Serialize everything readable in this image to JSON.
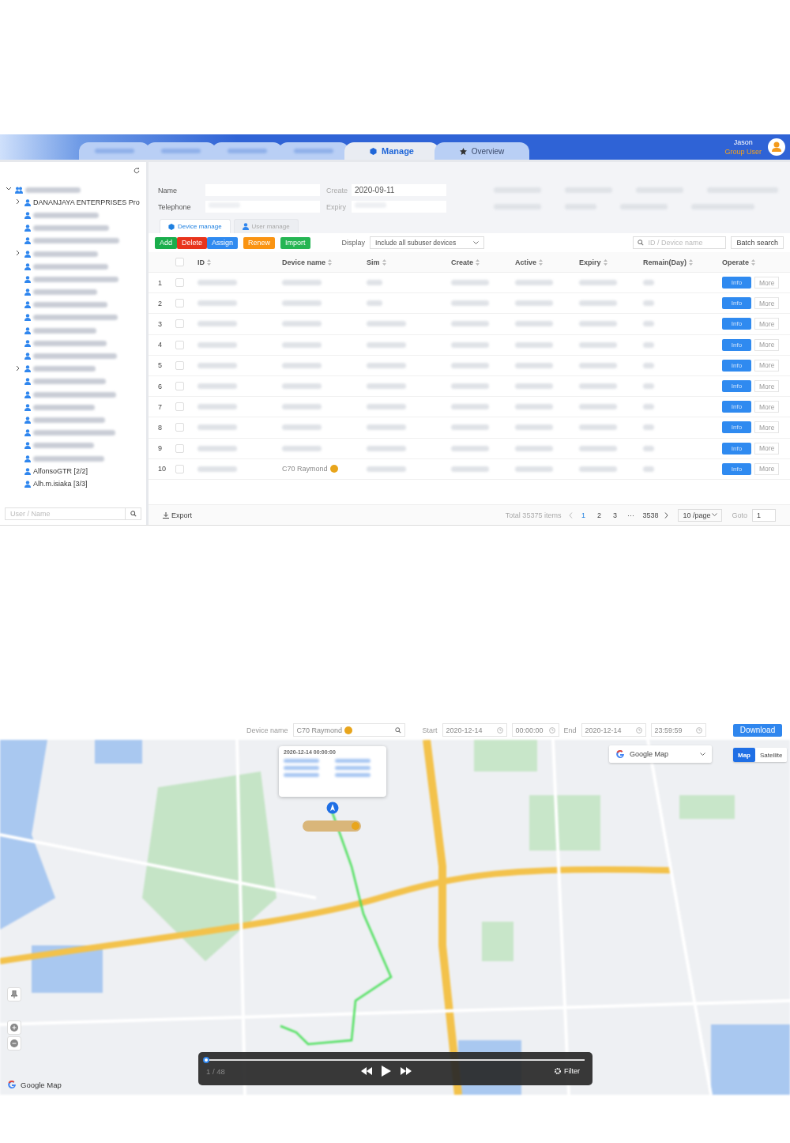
{
  "header": {
    "tabs": [
      {
        "kind": "blurred",
        "selected": false
      },
      {
        "kind": "blurred",
        "selected": false
      },
      {
        "kind": "blurred",
        "selected": false
      },
      {
        "kind": "blurred",
        "selected": false
      },
      {
        "kind": "cube",
        "label": "Manage",
        "selected": true
      },
      {
        "kind": "star",
        "label": "Overview",
        "selected": false
      }
    ],
    "user": {
      "name": "Jason",
      "role": "Group User"
    }
  },
  "sidebar": {
    "tree": {
      "kind": "blurred",
      "expanded": true,
      "children": [
        {
          "kind": "text",
          "label": "DANANJAYA ENTERPRISES Pro",
          "has_children": true
        },
        {
          "kind": "blurred",
          "has_children": false
        },
        {
          "kind": "blurred",
          "has_children": false
        },
        {
          "kind": "blurred",
          "has_children": false
        },
        {
          "kind": "blurred",
          "has_children": true
        },
        {
          "kind": "blurred",
          "has_children": false
        },
        {
          "kind": "blurred",
          "has_children": false
        },
        {
          "kind": "blurred",
          "has_children": false
        },
        {
          "kind": "blurred",
          "has_children": false
        },
        {
          "kind": "blurred",
          "has_children": false
        },
        {
          "kind": "blurred",
          "has_children": false
        },
        {
          "kind": "blurred",
          "has_children": false
        },
        {
          "kind": "blurred",
          "has_children": false
        },
        {
          "kind": "blurred",
          "has_children": true
        },
        {
          "kind": "blurred",
          "has_children": false
        },
        {
          "kind": "blurred",
          "has_children": false
        },
        {
          "kind": "blurred",
          "has_children": false
        },
        {
          "kind": "blurred",
          "has_children": false
        },
        {
          "kind": "blurred",
          "has_children": false
        },
        {
          "kind": "blurred",
          "has_children": false
        },
        {
          "kind": "blurred",
          "has_children": false
        },
        {
          "kind": "text",
          "label": "AlfonsoGTR [2/2]",
          "has_children": false
        },
        {
          "kind": "text",
          "label": "Alh.m.isiaka [3/3]",
          "has_children": false
        }
      ]
    },
    "search": {
      "placeholder": "User / Name"
    }
  },
  "filters": [
    {
      "label": "Name"
    },
    {
      "label": "Create",
      "value": "2020-09-11"
    },
    {
      "label": "Telephone"
    },
    {
      "label": "Expiry"
    }
  ],
  "subtabs": [
    {
      "label": "Device manage",
      "selected": true
    },
    {
      "label": "User manage",
      "selected": false
    }
  ],
  "actions": [
    {
      "label": "Add",
      "color": "#1aad4b"
    },
    {
      "label": "Delete",
      "color": "#e8341c"
    },
    {
      "label": "Assign",
      "color": "#2f8af0"
    },
    {
      "label": "Renew",
      "color": "#fa9412"
    },
    {
      "label": "Import",
      "color": "#25b553"
    }
  ],
  "display": {
    "label": "Display",
    "value": "Include all subuser devices"
  },
  "search": {
    "placeholder": "ID / Device name",
    "batch": "Batch search"
  },
  "table": {
    "select_all": {
      "checked": false
    },
    "columns": [
      "ID",
      "Device name",
      "Sim",
      "Create",
      "Active",
      "Expiry",
      "Remain(Day)",
      "Operate"
    ],
    "rows": [
      {
        "index": "1",
        "checked": false,
        "info": "Info",
        "more": "More"
      },
      {
        "index": "2",
        "checked": false,
        "info": "Info",
        "more": "More"
      },
      {
        "index": "3",
        "checked": false,
        "info": "Info",
        "more": "More"
      },
      {
        "index": "4",
        "checked": false,
        "info": "Info",
        "more": "More"
      },
      {
        "index": "5",
        "checked": false,
        "info": "Info",
        "more": "More"
      },
      {
        "index": "6",
        "checked": false,
        "info": "Info",
        "more": "More"
      },
      {
        "index": "7",
        "checked": false,
        "info": "Info",
        "more": "More"
      },
      {
        "index": "8",
        "checked": false,
        "info": "Info",
        "more": "More"
      },
      {
        "index": "9",
        "checked": false,
        "info": "Info",
        "more": "More"
      },
      {
        "index": "10",
        "checked": false,
        "device_name": "C70 Raymond",
        "info": "Info",
        "more": "More"
      }
    ]
  },
  "footer": {
    "export": "Export",
    "total": "Total 35375 items",
    "pages": [
      {
        "label": "1",
        "selected": true
      },
      {
        "label": "2",
        "selected": false
      },
      {
        "label": "3",
        "selected": false
      },
      {
        "label": "···",
        "selected": false
      },
      {
        "label": "3538",
        "selected": false
      }
    ],
    "page_size": "10 /page",
    "goto_label": "Goto",
    "goto_value": "1"
  },
  "track": {
    "device_label": "Device name",
    "device_value": "C70 Raymond",
    "start_label": "Start",
    "start_date": "2020-12-14",
    "start_time": "00:00:00",
    "end_label": "End",
    "end_date": "2020-12-14",
    "end_time": "23:59:59",
    "download": "Download",
    "map_source": "Google Map",
    "map_types": [
      {
        "label": "Map",
        "selected": true
      },
      {
        "label": "Satellite",
        "selected": false
      }
    ],
    "popup_time": "2020-12-14 00:00:00",
    "playback": {
      "level": 0.0,
      "counter": "1 / 48",
      "filter": "Filter"
    },
    "logo": "Google Map"
  }
}
